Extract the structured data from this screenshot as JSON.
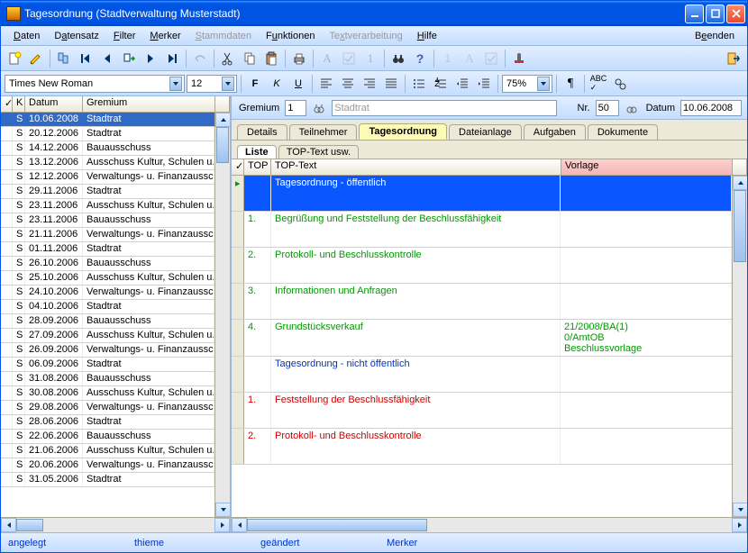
{
  "window": {
    "title": "Tagesordnung (Stadtverwaltung Musterstadt)"
  },
  "menus": {
    "daten": "Daten",
    "datensatz": "Datensatz",
    "filter": "Filter",
    "merker": "Merker",
    "stammdaten": "Stammdaten",
    "funktionen": "Funktionen",
    "textverarbeitung": "Textverarbeitung",
    "hilfe": "Hilfe",
    "beenden": "Beenden"
  },
  "format": {
    "font": "Times New Roman",
    "size": "12",
    "zoom": "75%"
  },
  "leftgrid": {
    "headers": {
      "check": "✓",
      "k": "K",
      "datum": "Datum",
      "gremium": "Gremium"
    },
    "rows": [
      {
        "k": "S",
        "datum": "10.06.2008",
        "gremium": "Stadtrat",
        "selected": true
      },
      {
        "k": "S",
        "datum": "20.12.2006",
        "gremium": "Stadtrat"
      },
      {
        "k": "S",
        "datum": "14.12.2006",
        "gremium": "Bauausschuss"
      },
      {
        "k": "S",
        "datum": "13.12.2006",
        "gremium": "Ausschuss Kultur, Schulen u."
      },
      {
        "k": "S",
        "datum": "12.12.2006",
        "gremium": "Verwaltungs- u. Finanzaussch"
      },
      {
        "k": "S",
        "datum": "29.11.2006",
        "gremium": "Stadtrat"
      },
      {
        "k": "S",
        "datum": "23.11.2006",
        "gremium": "Ausschuss Kultur, Schulen u."
      },
      {
        "k": "S",
        "datum": "23.11.2006",
        "gremium": "Bauausschuss"
      },
      {
        "k": "S",
        "datum": "21.11.2006",
        "gremium": "Verwaltungs- u. Finanzaussch"
      },
      {
        "k": "S",
        "datum": "01.11.2006",
        "gremium": "Stadtrat"
      },
      {
        "k": "S",
        "datum": "26.10.2006",
        "gremium": "Bauausschuss"
      },
      {
        "k": "S",
        "datum": "25.10.2006",
        "gremium": "Ausschuss Kultur, Schulen u."
      },
      {
        "k": "S",
        "datum": "24.10.2006",
        "gremium": "Verwaltungs- u. Finanzaussch"
      },
      {
        "k": "S",
        "datum": "04.10.2006",
        "gremium": "Stadtrat"
      },
      {
        "k": "S",
        "datum": "28.09.2006",
        "gremium": "Bauausschuss"
      },
      {
        "k": "S",
        "datum": "27.09.2006",
        "gremium": "Ausschuss Kultur, Schulen u."
      },
      {
        "k": "S",
        "datum": "26.09.2006",
        "gremium": "Verwaltungs- u. Finanzaussch"
      },
      {
        "k": "S",
        "datum": "06.09.2006",
        "gremium": "Stadtrat"
      },
      {
        "k": "S",
        "datum": "31.08.2006",
        "gremium": "Bauausschuss"
      },
      {
        "k": "S",
        "datum": "30.08.2006",
        "gremium": "Ausschuss Kultur, Schulen u."
      },
      {
        "k": "S",
        "datum": "29.08.2006",
        "gremium": "Verwaltungs- u. Finanzaussch"
      },
      {
        "k": "S",
        "datum": "28.06.2006",
        "gremium": "Stadtrat"
      },
      {
        "k": "S",
        "datum": "22.06.2006",
        "gremium": "Bauausschuss"
      },
      {
        "k": "S",
        "datum": "21.06.2006",
        "gremium": "Ausschuss Kultur, Schulen u."
      },
      {
        "k": "S",
        "datum": "20.06.2006",
        "gremium": "Verwaltungs- u. Finanzaussch"
      },
      {
        "k": "S",
        "datum": "31.05.2006",
        "gremium": "Stadtrat"
      }
    ]
  },
  "detail": {
    "gremium_label": "Gremium",
    "gremium_val": "1",
    "gremium_name": "Stadtrat",
    "nr_label": "Nr.",
    "nr_val": "50",
    "datum_label": "Datum",
    "datum_val": "10.06.2008"
  },
  "tabs": {
    "details": "Details",
    "teilnehmer": "Teilnehmer",
    "tagesordnung": "Tagesordnung",
    "dateianlage": "Dateianlage",
    "aufgaben": "Aufgaben",
    "dokumente": "Dokumente"
  },
  "innertabs": {
    "liste": "Liste",
    "toptext": "TOP-Text usw."
  },
  "rgrid": {
    "headers": {
      "check": "✓",
      "top": "TOP",
      "toptext": "TOP-Text",
      "vorlage": "Vorlage"
    },
    "rows": [
      {
        "top": "",
        "text": "Tagesordnung - öffentlich",
        "vorlage": "",
        "cls": "",
        "selected": true,
        "greencaret": true,
        "textcolor": ""
      },
      {
        "top": "1.",
        "text": "Begrüßung und Feststellung der Beschlussfähigkeit",
        "vorlage": "",
        "textcolor": "green"
      },
      {
        "top": "2.",
        "text": "Protokoll- und Beschlusskontrolle",
        "vorlage": "",
        "textcolor": "green"
      },
      {
        "top": "3.",
        "text": "Informationen und Anfragen",
        "vorlage": "",
        "textcolor": "green"
      },
      {
        "top": "4.",
        "text": "Grundstücksverkauf",
        "vorlage": "21/2008/BA(1)\n0/AmtOB\nBeschlussvorlage",
        "textcolor": "green"
      },
      {
        "top": "",
        "text": "Tagesordnung - nicht öffentlich",
        "vorlage": "",
        "textcolor": "blue"
      },
      {
        "top": "1.",
        "text": "Feststellung der Beschlussfähigkeit",
        "vorlage": "",
        "textcolor": "red"
      },
      {
        "top": "2.",
        "text": "Protokoll- und Beschlusskontrolle",
        "vorlage": "",
        "textcolor": "red"
      }
    ]
  },
  "status": {
    "angelegt": "angelegt",
    "thieme": "thieme",
    "geaendert": "geändert",
    "merker": "Merker"
  }
}
